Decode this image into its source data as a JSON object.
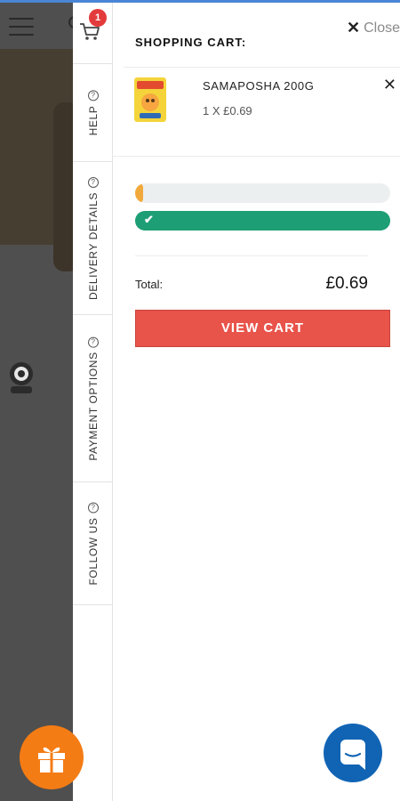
{
  "header": {
    "cart_count": "1"
  },
  "tabs": [
    {
      "label": "HELP",
      "icon": "question-circle-icon"
    },
    {
      "label": "DELIVERY DETAILS",
      "icon": "question-circle-icon"
    },
    {
      "label": "PAYMENT OPTIONS",
      "icon": "question-circle-icon"
    },
    {
      "label": "FOLLOW US",
      "icon": "question-circle-icon"
    }
  ],
  "cart": {
    "close_label": "Close",
    "title": "SHOPPING CART:",
    "items": [
      {
        "name": "SAMAPOSHA 200G",
        "quantity_price": "1 X £0.69"
      }
    ],
    "progress": {
      "first_fill": 0.03,
      "second_fill": 1.0
    },
    "total_label": "Total:",
    "total_value": "£0.69",
    "view_cart_label": "VIEW CART"
  },
  "colors": {
    "accent_blue": "#4b85d6",
    "badge_red": "#e33b3b",
    "button_red": "#e8534a",
    "progress_green": "#1e9e75",
    "gift_orange": "#f47c14",
    "chat_blue": "#1164b4"
  }
}
